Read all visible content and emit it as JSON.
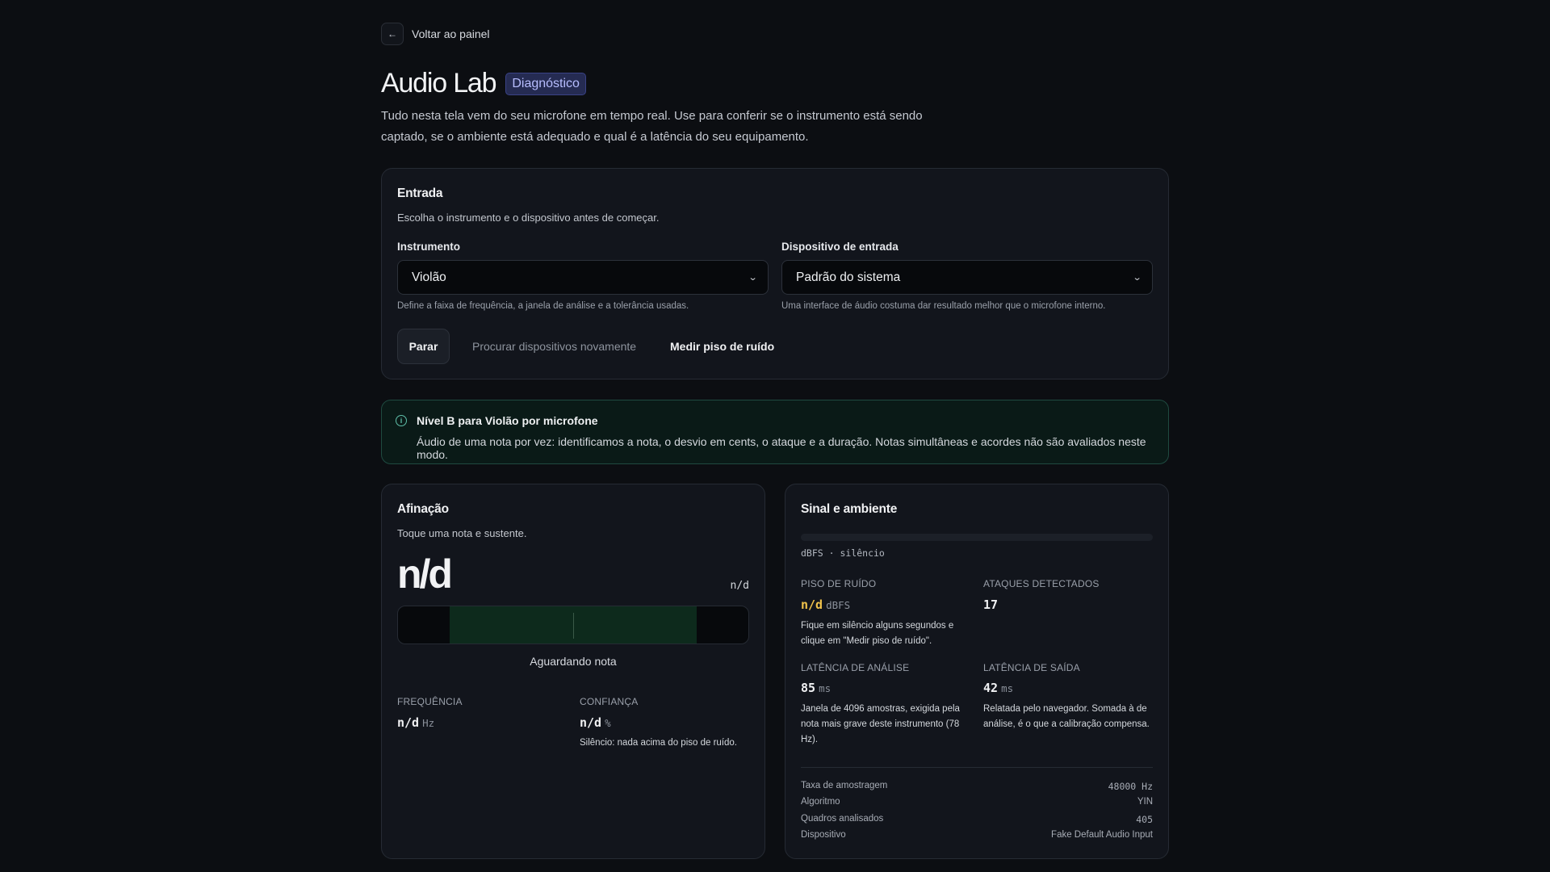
{
  "back": {
    "label": "Voltar ao painel",
    "icon": "arrow-left-icon"
  },
  "header": {
    "title": "Audio Lab",
    "badge": "Diagnóstico",
    "intro": "Tudo nesta tela vem do seu microfone em tempo real. Use para conferir se o instrumento está sendo captado, se o ambiente está adequado e qual é a latência do seu equipamento."
  },
  "entrada": {
    "title": "Entrada",
    "subtitle": "Escolha o instrumento e o dispositivo antes de começar.",
    "instrument": {
      "label": "Instrumento",
      "value": "Violão",
      "hint": "Define a faixa de frequência, a janela de análise e a tolerância usadas."
    },
    "device": {
      "label": "Dispositivo de entrada",
      "value": "Padrão do sistema",
      "hint": "Uma interface de áudio costuma dar resultado melhor que o microfone interno."
    },
    "buttons": {
      "stop": "Parar",
      "rescan": "Procurar dispositivos novamente",
      "noise": "Medir piso de ruído"
    }
  },
  "info": {
    "title": "Nível B para Violão por microfone",
    "text": "Áudio de uma nota por vez: identificamos a nota, o desvio em cents, o ataque e a duração. Notas simultâneas e acordes não são avaliados neste modo."
  },
  "afinacao": {
    "title": "Afinação",
    "subtitle": "Toque uma nota e sustente.",
    "note": "n/d",
    "note_side": "n/d",
    "status": "Aguardando nota",
    "frequency": {
      "label": "FREQUÊNCIA",
      "value": "n/d",
      "unit": "Hz"
    },
    "confidence": {
      "label": "CONFIANÇA",
      "value": "n/d",
      "unit": "%",
      "note": "Silêncio: nada acima do piso de ruído."
    }
  },
  "sinal": {
    "title": "Sinal e ambiente",
    "caption": "dBFS · silêncio",
    "noise_floor": {
      "label": "PISO DE RUÍDO",
      "value": "n/d",
      "unit": "dBFS",
      "note": "Fique em silêncio alguns segundos e clique em \"Medir piso de ruído\"."
    },
    "attacks": {
      "label": "ATAQUES DETECTADOS",
      "value": "17"
    },
    "analysis_latency": {
      "label": "LATÊNCIA DE ANÁLISE",
      "value": "85",
      "unit": "ms",
      "note": "Janela de 4096 amostras, exigida pela nota mais grave deste instrumento (78 Hz)."
    },
    "output_latency": {
      "label": "LATÊNCIA DE SAÍDA",
      "value": "42",
      "unit": "ms",
      "note": "Relatada pelo navegador. Somada à de análise, é o que a calibração compensa."
    },
    "details": [
      {
        "key": "Taxa de amostragem",
        "value": "48000 Hz"
      },
      {
        "key": "Algoritmo",
        "value": "YIN"
      },
      {
        "key": "Quadros analisados",
        "value": "405"
      },
      {
        "key": "Dispositivo",
        "value": "Fake Default Audio Input"
      }
    ]
  },
  "colors": {
    "accent_badge": "#b7bdff",
    "info_border": "#1f4a40",
    "warning": "#f0c24b"
  }
}
